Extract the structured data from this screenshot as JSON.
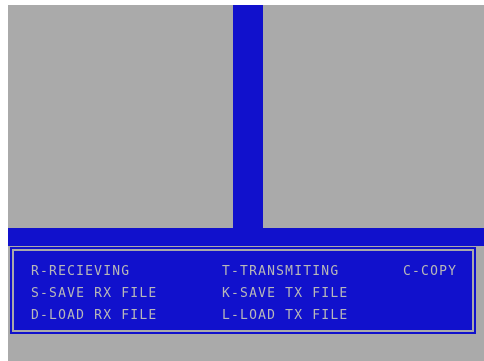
{
  "menu": {
    "receiving": "R-RECIEVING",
    "transmitting": "T-TRANSMITING",
    "copy": "C-COPY",
    "save_rx": "S-SAVE RX FILE",
    "save_tx": "K-SAVE TX FILE",
    "load_rx": "D-LOAD RX FILE",
    "load_tx": "L-LOAD TX FILE"
  },
  "colors": {
    "background": "#aaaaaa",
    "accent": "#1111cc",
    "text": "#b8b8b8"
  }
}
